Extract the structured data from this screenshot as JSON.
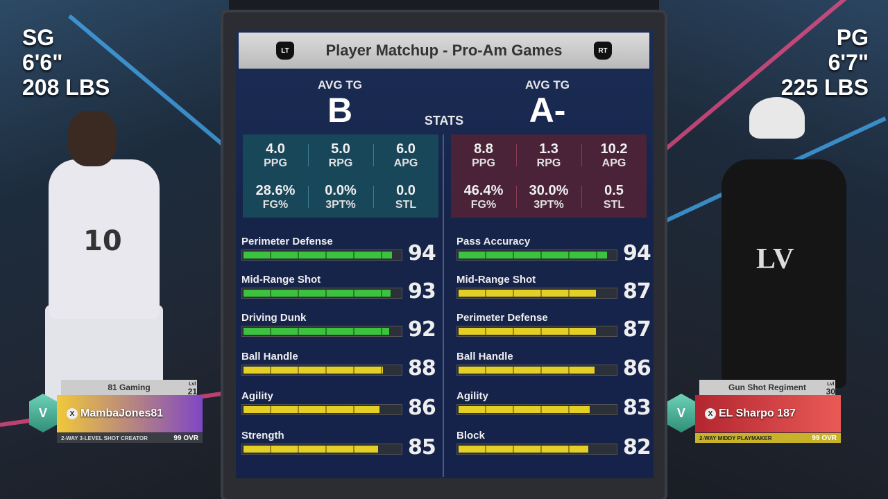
{
  "title": "Player Matchup - Pro-Am Games",
  "left_trigger": "LT",
  "right_trigger": "RT",
  "stats_label": "STATS",
  "left_player": {
    "position": "SG",
    "height": "6'6\"",
    "weight": "208 LBS",
    "avg_tg_label": "AVG TG",
    "grade": "B",
    "jersey_number": "10",
    "team": "81 Gaming",
    "level_label": "Lvl",
    "level": "21",
    "gamertag": "MambaJones81",
    "archetype": "2-WAY 3-LEVEL SHOT CREATOR",
    "ovr": "99",
    "stats": [
      {
        "value": "4.0",
        "label": "PPG"
      },
      {
        "value": "5.0",
        "label": "RPG"
      },
      {
        "value": "6.0",
        "label": "APG"
      },
      {
        "value": "28.6%",
        "label": "FG%"
      },
      {
        "value": "0.0%",
        "label": "3PT%"
      },
      {
        "value": "0.0",
        "label": "STL"
      }
    ],
    "attributes": [
      {
        "name": "Perimeter Defense",
        "value": "94",
        "color": "green"
      },
      {
        "name": "Mid-Range Shot",
        "value": "93",
        "color": "green"
      },
      {
        "name": "Driving Dunk",
        "value": "92",
        "color": "green"
      },
      {
        "name": "Ball Handle",
        "value": "88",
        "color": "yellow"
      },
      {
        "name": "Agility",
        "value": "86",
        "color": "yellow"
      },
      {
        "name": "Strength",
        "value": "85",
        "color": "yellow"
      }
    ]
  },
  "right_player": {
    "position": "PG",
    "height": "6'7\"",
    "weight": "225 LBS",
    "avg_tg_label": "AVG TG",
    "grade": "A-",
    "team": "Gun Shot Regiment",
    "level_label": "Lvl",
    "level": "30",
    "gamertag": "EL Sharpo 187",
    "archetype": "2-WAY MIDDY PLAYMAKER",
    "ovr": "99",
    "stats": [
      {
        "value": "8.8",
        "label": "PPG"
      },
      {
        "value": "1.3",
        "label": "RPG"
      },
      {
        "value": "10.2",
        "label": "APG"
      },
      {
        "value": "46.4%",
        "label": "FG%"
      },
      {
        "value": "30.0%",
        "label": "3PT%"
      },
      {
        "value": "0.5",
        "label": "STL"
      }
    ],
    "attributes": [
      {
        "name": "Pass Accuracy",
        "value": "94",
        "color": "green"
      },
      {
        "name": "Mid-Range Shot",
        "value": "87",
        "color": "yellow"
      },
      {
        "name": "Perimeter Defense",
        "value": "87",
        "color": "yellow"
      },
      {
        "name": "Ball Handle",
        "value": "86",
        "color": "yellow"
      },
      {
        "name": "Agility",
        "value": "83",
        "color": "yellow"
      },
      {
        "name": "Block",
        "value": "82",
        "color": "yellow"
      }
    ]
  },
  "overlay_text": {
    "right_jersey_logo": "LV",
    "card_badge": "V",
    "xbox_glyph": "X",
    "ovr_suffix": "OVR"
  },
  "colors": {
    "green_bar": "#3bc23e",
    "yellow_bar": "#e3cf25",
    "board": "#1b2d55"
  }
}
